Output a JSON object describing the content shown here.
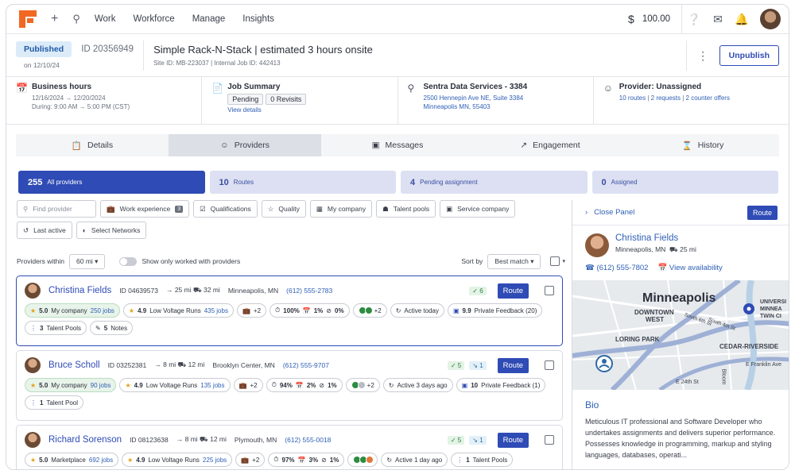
{
  "nav": {
    "links": [
      "Work",
      "Workforce",
      "Manage",
      "Insights"
    ],
    "balance": "100.00"
  },
  "header": {
    "status": "Published",
    "date": "on 12/10/24",
    "id": "ID 20356949",
    "title": "Simple Rack-N-Stack | estimated 3 hours onsite",
    "sub": "Site ID: MB-223037 | Internal Job ID: 442413",
    "unpublish": "Unpublish"
  },
  "info": {
    "hours": {
      "title": "Business hours",
      "range": "12/16/2024 → 12/20/2024",
      "during": "During:  9:00 AM → 5:00 PM (CST)"
    },
    "job": {
      "title": "Job Summary",
      "pending": "Pending",
      "revisits": "0 Revisits",
      "details": "View details"
    },
    "site": {
      "title": "Sentra Data Services - 3384",
      "addr1": "2500 Hennepin Ave NE, Suite 3384",
      "addr2": "Minneapolis MN, 55403"
    },
    "provider": {
      "title": "Provider: Unassigned",
      "routes": "10 routes",
      "requests": "2 requests",
      "counters": "2 counter offers"
    }
  },
  "tabs": [
    "Details",
    "Providers",
    "Messages",
    "Engagement",
    "History"
  ],
  "summary": [
    {
      "count": "255",
      "label": "All providers"
    },
    {
      "count": "10",
      "label": "Routes"
    },
    {
      "count": "4",
      "label": "Pending assignment"
    },
    {
      "count": "0",
      "label": "Assigned"
    }
  ],
  "filters": {
    "search_placeholder": "Find provider",
    "work_experience": "Work experience",
    "work_experience_count": "3",
    "qualifications": "Qualifications",
    "quality": "Quality",
    "my_company": "My company",
    "talent_pools": "Talent pools",
    "service_company": "Service company",
    "last_active": "Last active",
    "select_networks": "Select Networks"
  },
  "controls": {
    "within_label": "Providers within",
    "within_value": "60 mi",
    "worked_with": "Show only worked with providers",
    "sort_label": "Sort by",
    "sort_value": "Best match"
  },
  "cards": [
    {
      "name": "Christina Fields",
      "id": "ID 04639573",
      "dist": "25 mi",
      "drive": "32 mi",
      "city": "Minneapolis, MN",
      "phone": "(612) 555-2783",
      "checks": "6",
      "revs": "",
      "route": "Route",
      "tags": [
        "5.0",
        "My company",
        "250 jobs",
        "4.9",
        "Low Voltage Runs",
        "435 jobs",
        "+2",
        "100%",
        "1%",
        "0%",
        "+2",
        "Active today",
        "9.9",
        "Private Feedback (20)",
        "3",
        "Talent Pools",
        "5",
        "Notes"
      ]
    },
    {
      "name": "Bruce Scholl",
      "id": "ID 03252381",
      "dist": "8 mi",
      "drive": "12 mi",
      "city": "Brooklyn Center, MN",
      "phone": "(612) 555-9707",
      "checks": "5",
      "revs": "1",
      "route": "Route",
      "tags": [
        "5.0",
        "My company",
        "90 jobs",
        "4.9",
        "Low Voltage Runs",
        "135 jobs",
        "+2",
        "94%",
        "2%",
        "1%",
        "+2",
        "Active 3 days ago",
        "10",
        "Private Feedback (1)",
        "1",
        "Talent Pool"
      ]
    },
    {
      "name": "Richard Sorenson",
      "id": "ID 08123638",
      "dist": "8 mi",
      "drive": "12 mi",
      "city": "Plymouth, MN",
      "phone": "(612) 555-0018",
      "checks": "5",
      "revs": "1",
      "route": "Route",
      "tags": [
        "5.0",
        "Marketplace",
        "692 jobs",
        "4.9",
        "Low Voltage Runs",
        "225 jobs",
        "+2",
        "97%",
        "3%",
        "1%",
        "Active 1 day ago",
        "1",
        "Talent Pools"
      ]
    }
  ],
  "panel": {
    "close": "Close Panel",
    "route": "Route",
    "name": "Christina Fields",
    "loc": "Minneapolis, MN",
    "drive": "25 mi",
    "phone": "(612) 555-7802",
    "avail": "View availability",
    "map": {
      "city": "Minneapolis",
      "downtown": "DOWNTOWN",
      "west": "WEST",
      "loring": "LORING PARK",
      "cedar": "CEDAR-RIVERSIDE",
      "univ1": "UNIVERSI",
      "univ2": "MINNEA",
      "univ3": "TWIN CI",
      "franklin": "E Franklin Ave",
      "e24": "E 24th St",
      "bloom": "Bloom",
      "s6": "South 6th St",
      "s4": "South 4th St"
    },
    "bio_title": "Bio",
    "bio": "Meticulous IT professional and Software Developer who undertakes assignments and delivers superior performance. Possesses knowledge in programming, markup and styling languages, databases, operati..."
  }
}
